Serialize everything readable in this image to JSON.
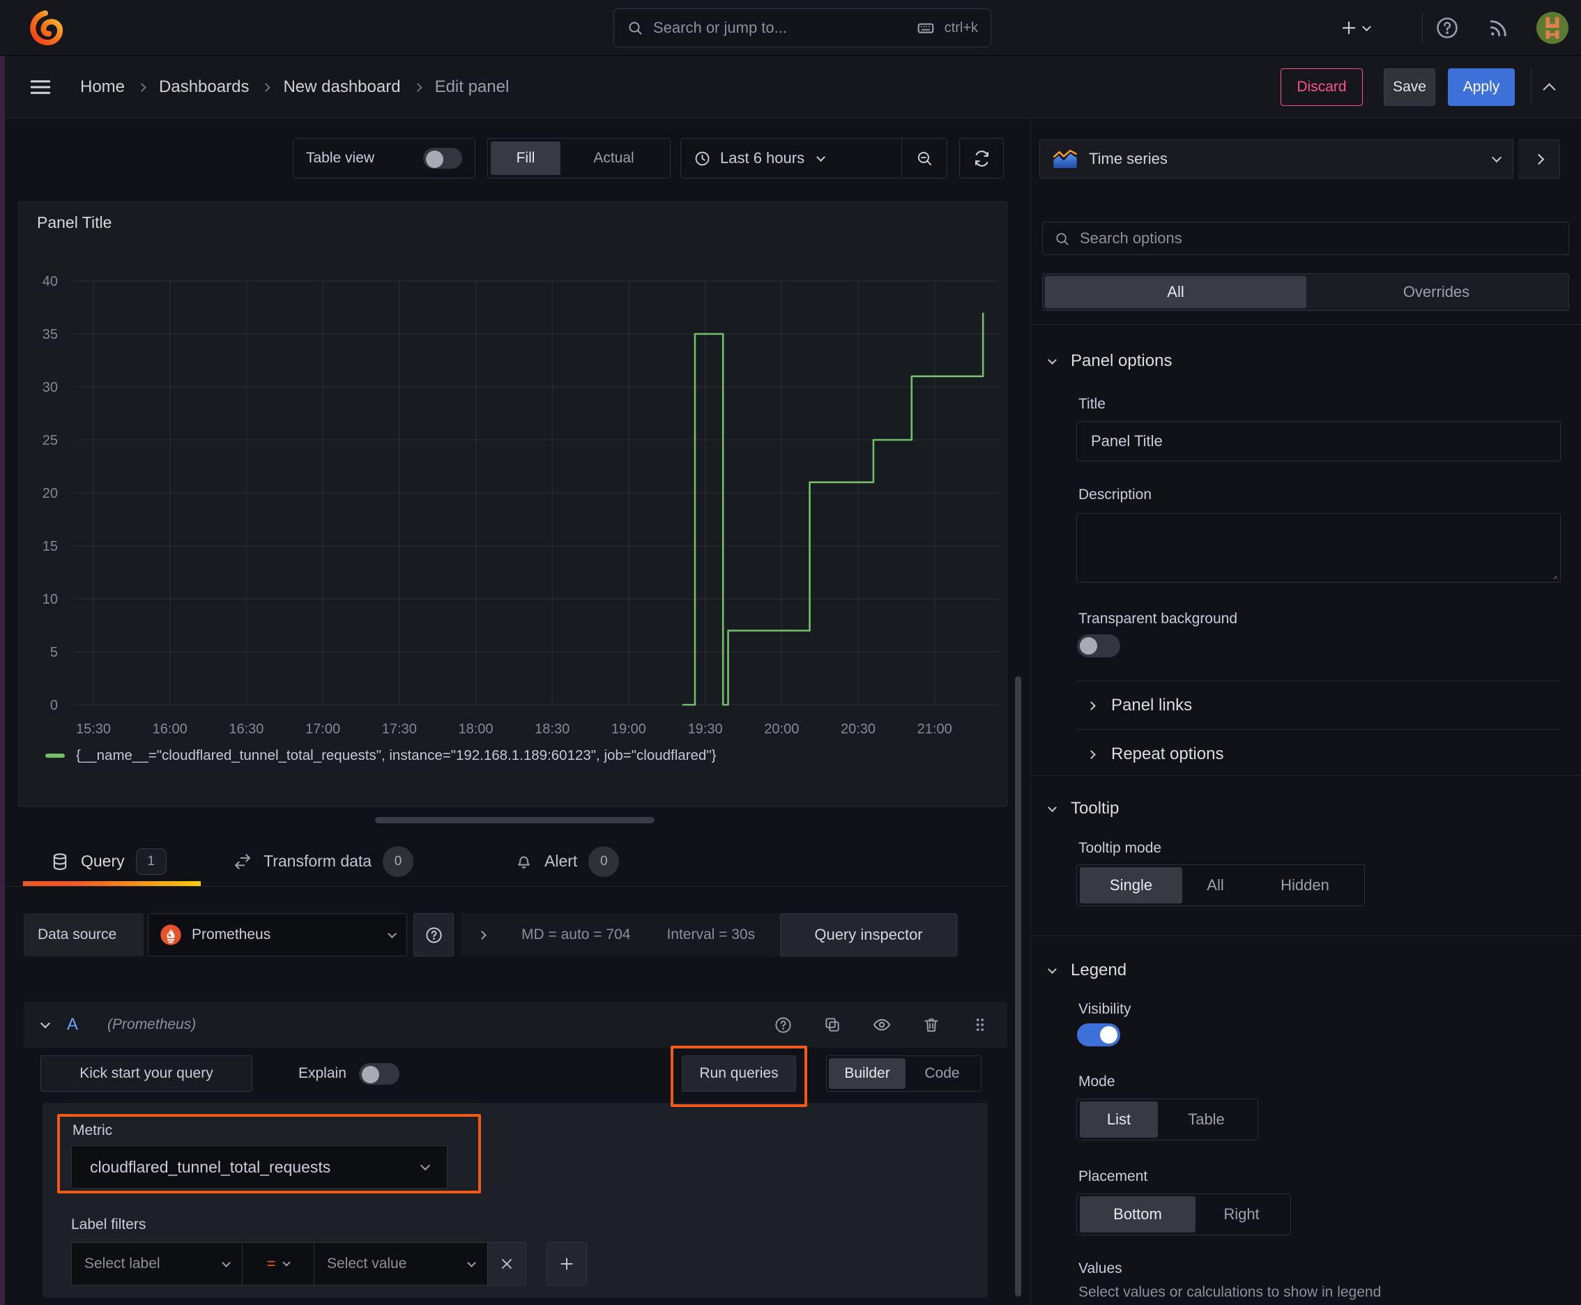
{
  "colors": {
    "accent_blue": "#3D71D9",
    "annotation_orange": "#EF5A1A",
    "series_green": "#73BF69",
    "error_pink": "#FF5286"
  },
  "topnav": {
    "search_placeholder": "Search or jump to...",
    "search_shortcut": "ctrl+k"
  },
  "breadcrumb": {
    "items": [
      "Home",
      "Dashboards",
      "New dashboard",
      "Edit panel"
    ],
    "discard": "Discard",
    "save": "Save",
    "apply": "Apply"
  },
  "toolbar": {
    "table_view": "Table view",
    "fill": "Fill",
    "actual": "Actual",
    "time_range": "Last 6 hours"
  },
  "panel": {
    "title": "Panel Title",
    "legend": "{__name__=\"cloudflared_tunnel_total_requests\", instance=\"192.168.1.189:60123\", job=\"cloudflared\"}"
  },
  "chart_data": {
    "type": "line",
    "title": "Panel Title",
    "x_ticks": [
      "15:30",
      "16:00",
      "16:30",
      "17:00",
      "17:30",
      "18:00",
      "18:30",
      "19:00",
      "19:30",
      "20:00",
      "20:30",
      "21:00"
    ],
    "y_ticks": [
      0,
      5,
      10,
      15,
      20,
      25,
      30,
      35,
      40
    ],
    "ylim": [
      0,
      40
    ],
    "grid": true,
    "legend_position": "bottom",
    "series": [
      {
        "name": "{__name__=\"cloudflared_tunnel_total_requests\", instance=\"192.168.1.189:60123\", job=\"cloudflared\"}",
        "color": "#73BF69",
        "points": [
          [
            "19:21",
            0
          ],
          [
            "19:26",
            0
          ],
          [
            "19:26",
            35
          ],
          [
            "19:37",
            35
          ],
          [
            "19:37",
            0
          ],
          [
            "19:39",
            0
          ],
          [
            "19:39",
            7
          ],
          [
            "20:11",
            7
          ],
          [
            "20:11",
            21
          ],
          [
            "20:36",
            21
          ],
          [
            "20:36",
            25
          ],
          [
            "20:51",
            25
          ],
          [
            "20:51",
            31
          ],
          [
            "21:19",
            31
          ],
          [
            "21:19",
            37
          ]
        ]
      }
    ]
  },
  "tabs": {
    "query": "Query",
    "query_count": "1",
    "transform": "Transform data",
    "transform_count": "0",
    "alert": "Alert",
    "alert_count": "0"
  },
  "query": {
    "datasource_label": "Data source",
    "datasource": "Prometheus",
    "stat_md": "MD = auto = 704",
    "stat_interval": "Interval = 30s",
    "inspector": "Query inspector",
    "ref_id": "A",
    "ref_ds": "(Prometheus)",
    "kickstart": "Kick start your query",
    "explain": "Explain",
    "run": "Run queries",
    "builder": "Builder",
    "code": "Code",
    "metric_label": "Metric",
    "metric_value": "cloudflared_tunnel_total_requests",
    "label_filters": "Label filters",
    "select_label": "Select label",
    "operator": "=",
    "select_value": "Select value"
  },
  "sidebar": {
    "viz": "Time series",
    "search_placeholder": "Search options",
    "tab_all": "All",
    "tab_overrides": "Overrides",
    "panel_options": "Panel options",
    "title_label": "Title",
    "title_value": "Panel Title",
    "description_label": "Description",
    "transparent": "Transparent background",
    "panel_links": "Panel links",
    "repeat_options": "Repeat options",
    "tooltip": "Tooltip",
    "tooltip_mode": "Tooltip mode",
    "single": "Single",
    "all": "All",
    "hidden": "Hidden",
    "legend": "Legend",
    "visibility": "Visibility",
    "mode": "Mode",
    "list": "List",
    "table": "Table",
    "placement": "Placement",
    "bottom": "Bottom",
    "right": "Right",
    "values": "Values",
    "values_help": "Select values or calculations to show in legend"
  }
}
